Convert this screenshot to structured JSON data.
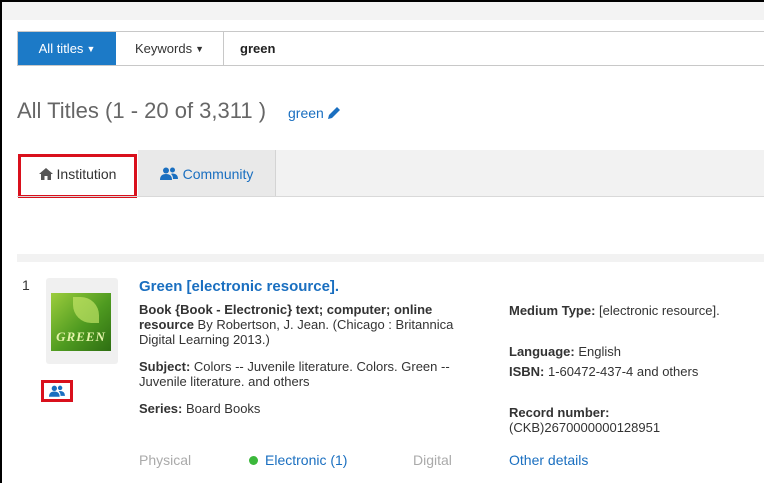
{
  "search": {
    "scope_label": "All titles",
    "field_label": "Keywords",
    "query": "green"
  },
  "results": {
    "title": "All Titles (1 - 20 of 3,311 )",
    "query_link": "green"
  },
  "tabs": [
    {
      "label": "Institution",
      "icon": "home-icon"
    },
    {
      "label": "Community",
      "icon": "users-icon"
    }
  ],
  "highlight_color": "#d9101c",
  "accent_color": "#1c7ac7",
  "record": {
    "number": "1",
    "cover_text": "GREEN",
    "title": "Green [electronic resource].",
    "desc_bold": "Book {Book - Electronic} text; computer; online resource",
    "desc_rest": " By Robertson, J. Jean. (Chicago : Britannica Digital Learning 2013.)",
    "subject_label": "Subject:",
    "subject_value": " Colors -- Juvenile literature. Colors. Green -- Juvenile literature. and others",
    "series_label": "Series:",
    "series_value": " Board Books",
    "medium_label": "Medium Type:",
    "medium_value": " [electronic resource].",
    "language_label": "Language:",
    "language_value": " English",
    "isbn_label": "ISBN:",
    "isbn_value": " 1-60472-437-4 and others",
    "record_label": "Record number:",
    "record_value": "(CKB)2670000000128951",
    "availability": {
      "physical": "Physical",
      "electronic": "Electronic (1)",
      "digital": "Digital",
      "other_details": "Other details"
    }
  }
}
